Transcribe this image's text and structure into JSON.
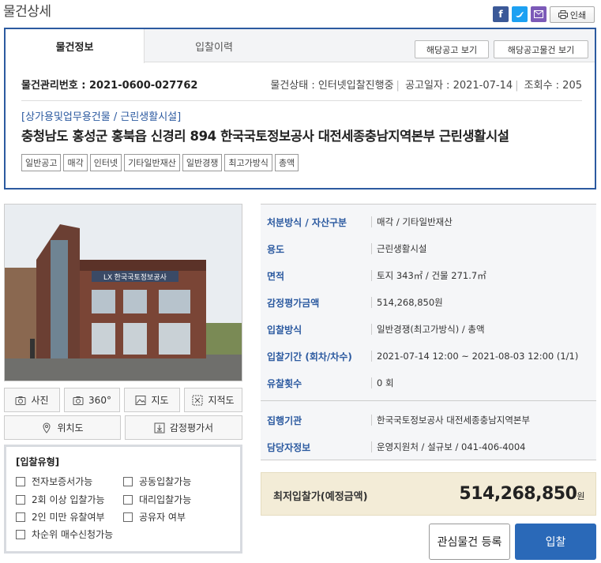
{
  "header": {
    "title": "물건상세",
    "print_label": "인쇄"
  },
  "share": {
    "facebook_color": "#3b5998",
    "twitter_color": "#1da1f2",
    "mail_color": "#7c5ab8"
  },
  "tabs": {
    "info": "물건정보",
    "history": "입찰이력"
  },
  "actions": {
    "notice": "해당공고 보기",
    "notice_items": "해당공고물건 보기"
  },
  "meta": {
    "mgmt_no": "물건관리번호 : 2021-0600-027762",
    "status": "물건상태 : 인터넷입찰진행중",
    "notice_date": "공고일자 : 2021-07-14",
    "views": "조회수 : 205"
  },
  "category": "[상가용및업무용건물 / 근린생활시설]",
  "address": "충청남도 홍성군 홍북읍 신경리 894 한국국토정보공사 대전세종충남지역본부 근린생활시설",
  "tags": [
    "일반공고",
    "매각",
    "인터넷",
    "기타일반재산",
    "일반경쟁",
    "최고가방식",
    "총액"
  ],
  "photo_buttons": {
    "photo": "사진",
    "view360": "360°",
    "map": "지도",
    "cadastral": "지적도",
    "location": "위치도",
    "appraisal": "감정평가서"
  },
  "bid_type": {
    "title": "[입찰유형]",
    "options": [
      "전자보증서가능",
      "공동입찰가능",
      "2회 이상 입찰가능",
      "대리입찰가능",
      "2인 미만 유찰여부",
      "공유자 여부",
      "차순위 매수신청가능"
    ]
  },
  "details": [
    {
      "label": "처분방식 / 자산구분",
      "value": "매각 / 기타일반재산"
    },
    {
      "label": "용도",
      "value": "근린생활시설"
    },
    {
      "label": "면적",
      "value": "토지 343㎡ / 건물 271.7㎡"
    },
    {
      "label": "감정평가금액",
      "value": "514,268,850원"
    },
    {
      "label": "입찰방식",
      "value": "일반경쟁(최고가방식) / 총액"
    },
    {
      "label": "입찰기간 (회차/차수)",
      "value": "2021-07-14 12:00 ~ 2021-08-03 12:00 (1/1)"
    },
    {
      "label": "유찰횟수",
      "value": "0 회"
    },
    {
      "label": "집행기관",
      "value": "한국국토정보공사 대전세종충남지역본부"
    },
    {
      "label": "담당자정보",
      "value": "운영지원처 / 설규보 / 041-406-4004"
    }
  ],
  "price": {
    "label": "최저입찰가(예정금액)",
    "value": "514,268,850",
    "unit": "원"
  },
  "buttons": {
    "interest": "관심물건 등록",
    "bid": "입찰"
  },
  "photo_sign": "LX 한국국토정보공사"
}
